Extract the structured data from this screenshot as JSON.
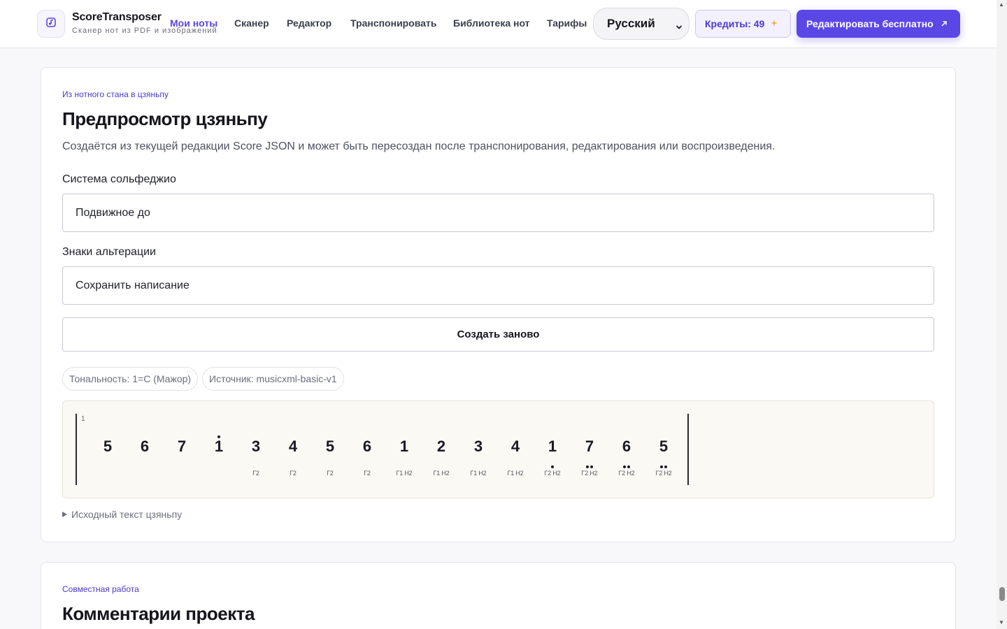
{
  "header": {
    "brand_name": "ScoreTransposer",
    "brand_tagline": "Сканер нот из PDF и изображений",
    "nav": [
      {
        "label": "Мои ноты",
        "active": true
      },
      {
        "label": "Сканер",
        "active": false
      },
      {
        "label": "Редактор",
        "active": false
      },
      {
        "label": "Транспонировать",
        "active": false
      },
      {
        "label": "Библиотека нот",
        "active": false
      },
      {
        "label": "Тарифы",
        "active": false
      }
    ],
    "language": "Русский",
    "credits_label": "Кредиты: 49",
    "cta_label": "Редактировать бесплатно",
    "accent_color": "#5b47e6"
  },
  "preview": {
    "eyebrow": "Из нотного стана в цзяньпу",
    "title": "Предпросмотр цзяньпу",
    "description": "Создаётся из текущей редакции Score JSON и может быть пересоздан после транспонирования, редактирования или воспроизведения.",
    "solfege_label": "Система сольфеджио",
    "solfege_value": "Подвижное до",
    "accidentals_label": "Знаки альтерации",
    "accidentals_value": "Сохранить написание",
    "regenerate_label": "Создать заново",
    "chips": [
      "Тональность: 1=C (Мажор)",
      "Источник: musicxml-basic-v1"
    ],
    "measure_number": "1",
    "notes": [
      {
        "digit": "5",
        "octave": 0,
        "lyric": ""
      },
      {
        "digit": "6",
        "octave": 0,
        "lyric": ""
      },
      {
        "digit": "7",
        "octave": 0,
        "lyric": ""
      },
      {
        "digit": "1",
        "octave": 1,
        "lyric": ""
      },
      {
        "digit": "3",
        "octave": 0,
        "lyric": "Г2"
      },
      {
        "digit": "4",
        "octave": 0,
        "lyric": "Г2"
      },
      {
        "digit": "5",
        "octave": 0,
        "lyric": "Г2"
      },
      {
        "digit": "6",
        "octave": 0,
        "lyric": "Г2"
      },
      {
        "digit": "1",
        "octave": 0,
        "lyric": "Г1 Н2"
      },
      {
        "digit": "2",
        "octave": 0,
        "lyric": "Г1 Н2"
      },
      {
        "digit": "3",
        "octave": 0,
        "lyric": "Г1 Н2"
      },
      {
        "digit": "4",
        "octave": 0,
        "lyric": "Г1 Н2"
      },
      {
        "digit": "1",
        "octave": -1,
        "lyric": "Г2 Н2"
      },
      {
        "digit": "7",
        "octave": -2,
        "lyric": "Г2 Н2"
      },
      {
        "digit": "6",
        "octave": -2,
        "lyric": "Г2 Н2"
      },
      {
        "digit": "5",
        "octave": -2,
        "lyric": "Г2 Н2"
      }
    ],
    "source_toggle": "Исходный текст цзяньпу"
  },
  "comments": {
    "eyebrow": "Совместная работа",
    "title": "Комментарии проекта"
  },
  "icons": {
    "logo": "music-note-icon",
    "credits": "sparkle-icon",
    "cta": "arrow-up-right-icon",
    "language": "chevron-down-icon",
    "source_toggle": "triangle-right-icon"
  }
}
